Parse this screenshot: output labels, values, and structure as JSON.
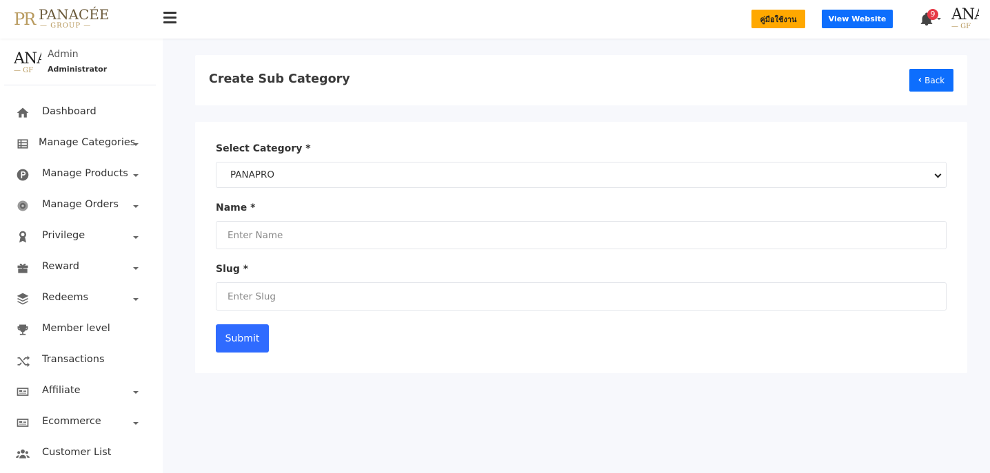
{
  "brand": {
    "monogram": "PR",
    "name": "PANACÉE",
    "sub": "— GROUP —"
  },
  "header": {
    "manual_label": "คู่มือใช้งาน",
    "website_label": "View Website",
    "notifications_count": "9",
    "avatar_text": "ANA",
    "avatar_sub": "— GF"
  },
  "user": {
    "name": "Admin",
    "role": "Administrator",
    "avatar_text": "ANA",
    "avatar_sub": "— GF"
  },
  "menu": [
    {
      "label": "Dashboard"
    },
    {
      "label": "Manage Categories"
    },
    {
      "label": "Manage Products"
    },
    {
      "label": "Manage Orders"
    },
    {
      "label": "Privilege"
    },
    {
      "label": "Reward"
    },
    {
      "label": "Redeems"
    },
    {
      "label": "Member level"
    },
    {
      "label": "Transactions"
    },
    {
      "label": "Affiliate"
    },
    {
      "label": "Ecommerce"
    },
    {
      "label": "Customer List"
    }
  ],
  "page": {
    "title": "Create Sub Category",
    "back_label": "Back"
  },
  "form": {
    "category_label": "Select Category *",
    "category_value": "PANAPRO",
    "name_label": "Name *",
    "name_placeholder": "Enter Name",
    "slug_label": "Slug *",
    "slug_placeholder": "Enter Slug",
    "submit_label": "Submit"
  },
  "colors": {
    "primary": "#0d6efd",
    "submit": "#2f6bff",
    "manual": "#ffa800",
    "badge": "#e63946",
    "brand_gold": "#b89a5e"
  }
}
